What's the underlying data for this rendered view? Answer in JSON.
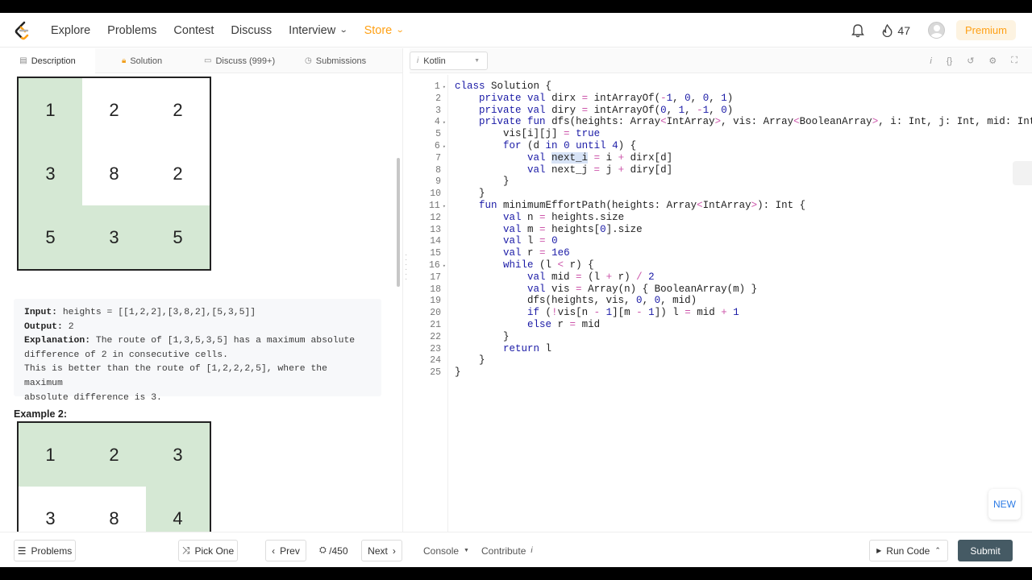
{
  "nav": {
    "links": [
      "Explore",
      "Problems",
      "Contest",
      "Discuss",
      "Interview",
      "Store"
    ],
    "streak_count": "47",
    "premium_label": "Premium",
    "store_color": "#ffa116"
  },
  "left_tabs": [
    "Description",
    "Solution",
    "Discuss (999+)",
    "Submissions"
  ],
  "example1_grid": [
    [
      "1",
      "2",
      "2"
    ],
    [
      "3",
      "8",
      "2"
    ],
    [
      "5",
      "3",
      "5"
    ]
  ],
  "example1": {
    "input_label": "Input:",
    "input_value": " heights = [[1,2,2],[3,8,2],[5,3,5]]",
    "output_label": "Output:",
    "output_value": " 2",
    "explanation_label": "Explanation:",
    "explanation_line1": " The route of [1,3,5,3,5] has a maximum absolute",
    "explanation_line2": "difference of 2 in consecutive cells.",
    "explanation_line3": "This is better than the route of [1,2,2,2,5], where the maximum",
    "explanation_line4": "absolute difference is 3."
  },
  "example2_title": "Example 2:",
  "example2_grid": [
    [
      "1",
      "2",
      "3"
    ],
    [
      "3",
      "8",
      "4"
    ]
  ],
  "editor": {
    "language": "Kotlin",
    "line_numbers": [
      "1",
      "2",
      "3",
      "4",
      "5",
      "6",
      "7",
      "8",
      "9",
      "10",
      "11",
      "12",
      "13",
      "14",
      "15",
      "16",
      "17",
      "18",
      "19",
      "20",
      "21",
      "22",
      "23",
      "24",
      "25"
    ],
    "code_lines": [
      "class Solution {",
      "    private val dirx = intArrayOf(-1, 0, 0, 1)",
      "    private val diry = intArrayOf(0, 1, -1, 0)",
      "    private fun dfs(heights: Array<IntArray>, vis: Array<BooleanArray>, i: Int, j: Int, mid: Int) {",
      "        vis[i][j] = true",
      "        for (d in 0 until 4) {",
      "            val next_i = i + dirx[d]",
      "            val next_j = j + diry[d]",
      "        }",
      "    }",
      "    fun minimumEffortPath(heights: Array<IntArray>): Int {",
      "        val n = heights.size",
      "        val m = heights[0].size",
      "        val l = 0",
      "        val r = 1e6",
      "        while (l < r) {",
      "            val mid = (l + r) / 2",
      "            val vis = Array(n) { BooleanArray(m) }",
      "            dfs(heights, vis, 0, 0, mid)",
      "            if (!vis[n - 1][m - 1]) l = mid + 1",
      "            else r = mid",
      "        }",
      "        return l",
      "    }",
      "}"
    ]
  },
  "new_badge": "NEW",
  "bottom": {
    "problems": "Problems",
    "pick_one": "Pick One",
    "prev": "Prev",
    "page": " /450",
    "next": "Next",
    "console": "Console",
    "contribute": "Contribute",
    "run_code": "Run Code",
    "submit": "Submit"
  }
}
